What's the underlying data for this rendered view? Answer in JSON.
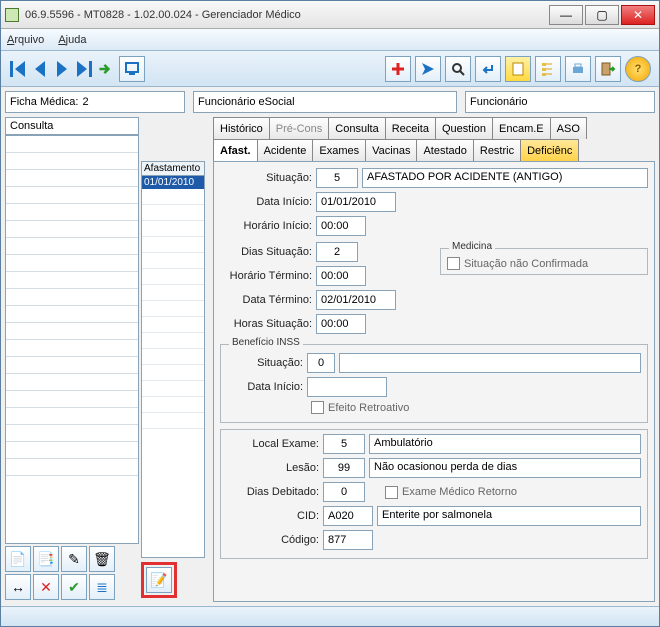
{
  "window": {
    "title": "06.9.5596 - MT0828 - 1.02.00.024 - Gerenciador Médico"
  },
  "menu": {
    "arquivo": "Arquivo",
    "ajuda": "Ajuda"
  },
  "ficha": {
    "label": "Ficha Médica:",
    "value": "2",
    "func_esocial": "Funcionário eSocial",
    "func": "Funcionário"
  },
  "left": {
    "consulta": "Consulta"
  },
  "mid": {
    "header": "Afastamento",
    "selected": "01/01/2010"
  },
  "tabs": {
    "row1": [
      "Histórico",
      "Pré-Cons",
      "Consulta",
      "Receita",
      "Question",
      "Encam.E",
      "ASO"
    ],
    "row2": [
      "Afast.",
      "Acidente",
      "Exames",
      "Vacinas",
      "Atestado",
      "Restric",
      "Deficiênc"
    ]
  },
  "form": {
    "situacao_label": "Situação:",
    "situacao_code": "5",
    "situacao_text": "AFASTADO POR ACIDENTE (ANTIGO)",
    "data_inicio_label": "Data Início:",
    "data_inicio": "01/01/2010",
    "hora_inicio_label": "Horário Início:",
    "hora_inicio": "00:00",
    "dias_sit_label": "Dias Situação:",
    "dias_sit": "2",
    "hora_term_label": "Horário Término:",
    "hora_term": "00:00",
    "data_term_label": "Data Término:",
    "data_term": "02/01/2010",
    "horas_sit_label": "Horas Situação:",
    "horas_sit": "00:00",
    "medicina_legend": "Medicina",
    "medicina_chk": "Situação não Confirmada",
    "inss_legend": "Benefício INSS",
    "inss_sit_label": "Situação:",
    "inss_sit": "0",
    "inss_data_label": "Data Início:",
    "inss_data": "",
    "efeito": "Efeito Retroativo",
    "local_label": "Local Exame:",
    "local_code": "5",
    "local_text": "Ambulatório",
    "lesao_label": "Lesão:",
    "lesao_code": "99",
    "lesao_text": "Não ocasionou perda de dias",
    "dias_deb_label": "Dias Debitado:",
    "dias_deb": "0",
    "exame_ret": "Exame Médico Retorno",
    "cid_label": "CID:",
    "cid_code": "A020",
    "cid_text": "Enterite por salmonela",
    "codigo_label": "Código:",
    "codigo": "877"
  }
}
